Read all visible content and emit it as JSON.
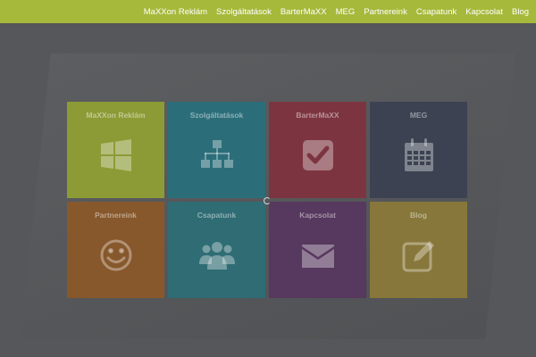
{
  "nav": {
    "items": [
      {
        "label": "MaXXon Reklám"
      },
      {
        "label": "Szolgáltatások"
      },
      {
        "label": "BarterMaXX"
      },
      {
        "label": "MEG"
      },
      {
        "label": "Partnereink"
      },
      {
        "label": "Csapatunk"
      },
      {
        "label": "Kapcsolat"
      },
      {
        "label": "Blog"
      }
    ]
  },
  "tiles": [
    {
      "title": "MaXXon Reklám",
      "icon": "windows-icon",
      "color": "#8d9b36"
    },
    {
      "title": "Szolgáltatások",
      "icon": "sitemap-icon",
      "color": "#2b6e79"
    },
    {
      "title": "BarterMaXX",
      "icon": "check-square-icon",
      "color": "#7c3540"
    },
    {
      "title": "MEG",
      "icon": "calendar-icon",
      "color": "#3c4252"
    },
    {
      "title": "Partnereink",
      "icon": "smile-icon",
      "color": "#87582c"
    },
    {
      "title": "Csapatunk",
      "icon": "group-icon",
      "color": "#2f6c74"
    },
    {
      "title": "Kapcsolat",
      "icon": "envelope-icon",
      "color": "#57385e"
    },
    {
      "title": "Blog",
      "icon": "edit-icon",
      "color": "#87773a"
    }
  ],
  "colors": {
    "nav_background": "#a7b93b",
    "overlay_background": "#55575a"
  }
}
